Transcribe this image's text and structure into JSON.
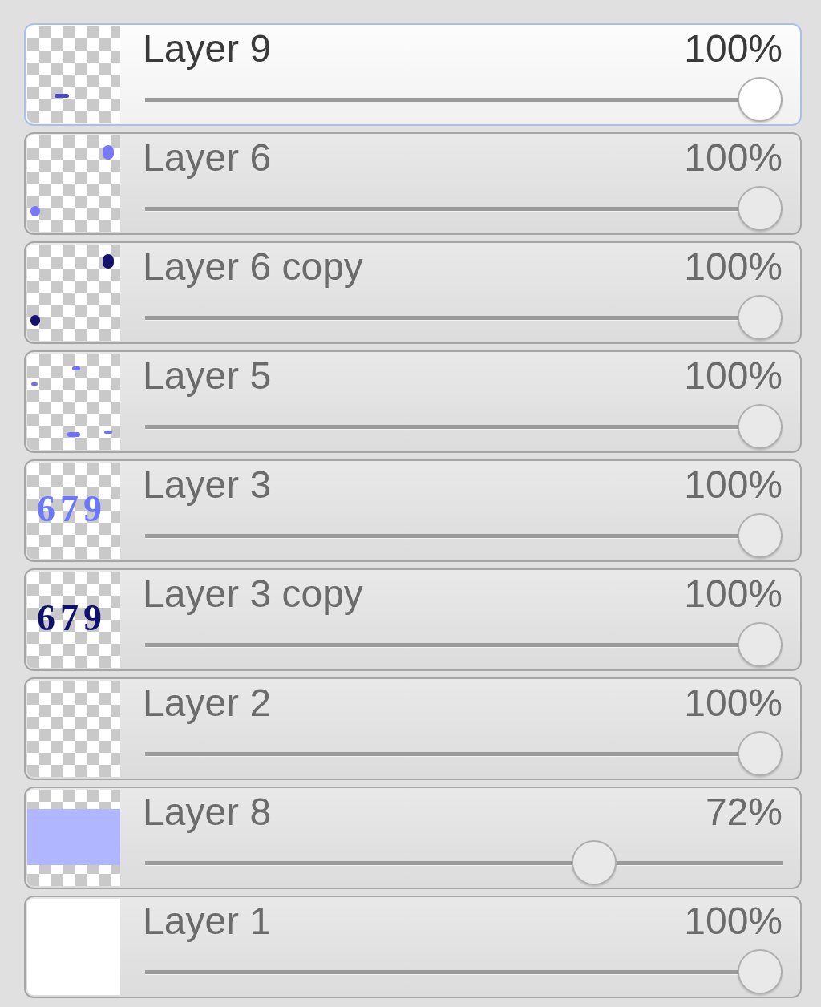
{
  "layers": [
    {
      "name": "Layer 9",
      "opacity": "100%",
      "level": 1,
      "selected": true,
      "thumbnail": {
        "kind": "dash",
        "color": "#4b4bc8"
      }
    },
    {
      "name": "Layer 6",
      "opacity": "100%",
      "level": 1,
      "selected": false,
      "thumbnail": {
        "kind": "corner-dots",
        "color": "#7878ff"
      }
    },
    {
      "name": "Layer 6 copy",
      "opacity": "100%",
      "level": 1,
      "selected": false,
      "thumbnail": {
        "kind": "corner-dots",
        "color": "#141470"
      }
    },
    {
      "name": "Layer 5",
      "opacity": "100%",
      "level": 1,
      "selected": false,
      "thumbnail": {
        "kind": "scatter",
        "color": "#6e6eff"
      }
    },
    {
      "name": "Layer 3",
      "opacity": "100%",
      "level": 1,
      "selected": false,
      "thumbnail": {
        "kind": "digits",
        "text": "679",
        "color": "#6a78ff"
      }
    },
    {
      "name": "Layer 3 copy",
      "opacity": "100%",
      "level": 1,
      "selected": false,
      "thumbnail": {
        "kind": "digits",
        "text": "679",
        "color": "#10106e"
      }
    },
    {
      "name": "Layer 2",
      "opacity": "100%",
      "level": 1,
      "selected": false,
      "thumbnail": {
        "kind": "empty"
      }
    },
    {
      "name": "Layer 8",
      "opacity": "72%",
      "level": 0.72,
      "selected": false,
      "thumbnail": {
        "kind": "band",
        "color": "#b0b6ff"
      }
    },
    {
      "name": "Layer 1",
      "opacity": "100%",
      "level": 1,
      "selected": false,
      "thumbnail": {
        "kind": "solid",
        "color": "#ffffff"
      }
    }
  ]
}
